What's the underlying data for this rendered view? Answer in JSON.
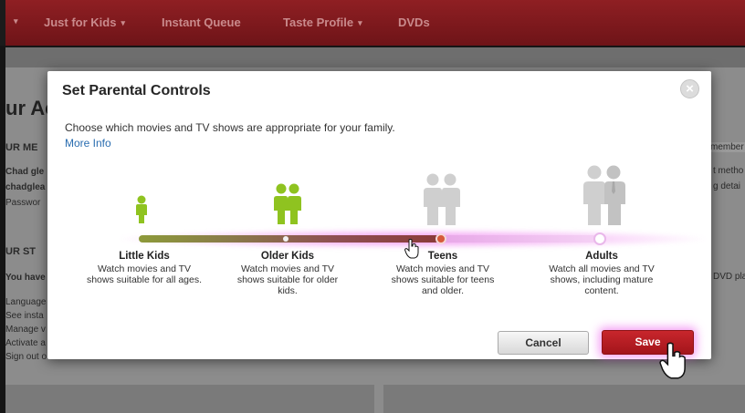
{
  "colors": {
    "nav_bg": "#7d181c",
    "nav_text": "#c98a8c",
    "save_bg": "#b51d23",
    "link": "#2a6db0",
    "kid_green": "#8fc320",
    "adult_gray": "#c9c9c9",
    "slider_glow": "#e850e8"
  },
  "nav": {
    "items": [
      {
        "label": "Just for Kids",
        "has_caret": true
      },
      {
        "label": "Instant Queue",
        "has_caret": false
      },
      {
        "label": "Taste Profile",
        "has_caret": true
      },
      {
        "label": "DVDs",
        "has_caret": false
      }
    ],
    "caret": "▾"
  },
  "background": {
    "heading": "ur Ac",
    "section1": "UR ME",
    "line1": "Chad gle",
    "line2": "chadglea",
    "line3": "Passwor",
    "section2": "UR ST",
    "line4": "You have",
    "line5": "Language",
    "line6": "See insta",
    "line7": "Manage v",
    "line8": "Activate a",
    "line9": "Sign out o",
    "right1": "member",
    "right2": "t metho",
    "right3": "g detai",
    "right4": "DVD pla"
  },
  "modal": {
    "title": "Set Parental Controls",
    "close_symbol": "×",
    "description": "Choose which movies and TV shows are appropriate for your family.",
    "more_info": "More Info",
    "selected_level": "Older Kids",
    "levels": [
      {
        "name": "Little Kids",
        "desc": "Watch movies and TV shows suitable for all ages.",
        "icon": "little-kid-icon"
      },
      {
        "name": "Older Kids",
        "desc": "Watch movies and TV shows suitable for older kids.",
        "icon": "older-kids-icon"
      },
      {
        "name": "Teens",
        "desc": "Watch movies and TV shows suitable for teens and older.",
        "icon": "teens-icon"
      },
      {
        "name": "Adults",
        "desc": "Watch all movies and TV shows, including mature content.",
        "icon": "adults-icon"
      }
    ],
    "cancel_label": "Cancel",
    "save_label": "Save"
  }
}
